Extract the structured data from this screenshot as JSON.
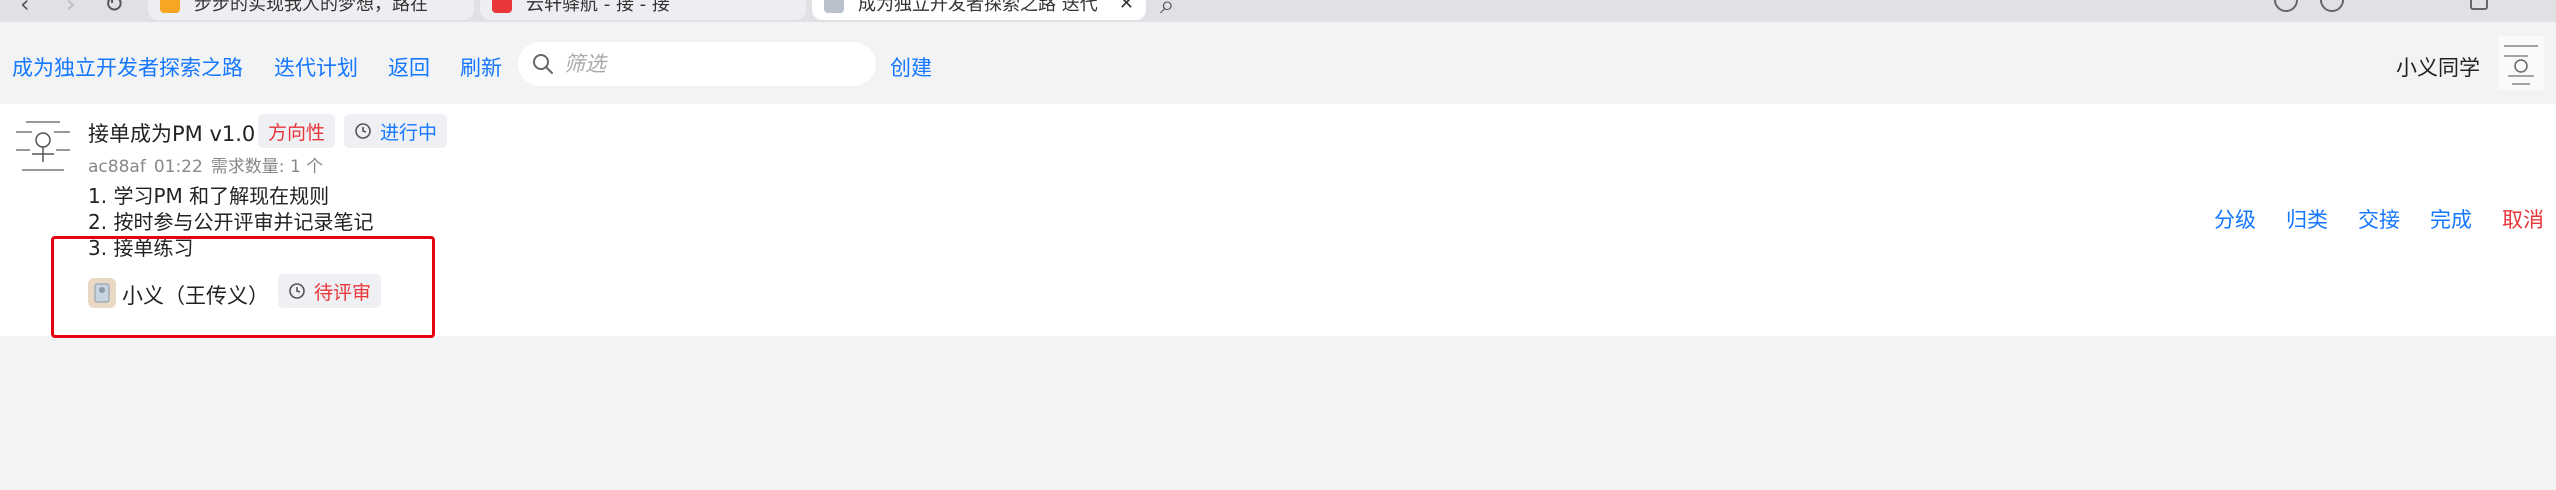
{
  "browser": {
    "tabs": [
      {
        "title": "步步的实现我人的梦想，路在"
      },
      {
        "title": "云轩驿航 - 接 - 接"
      },
      {
        "title": "成为独立开发者探索之路 迭代"
      }
    ],
    "close_glyph": "✕",
    "search_glyph": "⌕"
  },
  "topbar": {
    "project_link": "成为独立开发者探索之路",
    "iteration_link": "迭代计划",
    "back_link": "返回",
    "refresh_link": "刷新",
    "search_placeholder": "筛选",
    "create_link": "创建",
    "username": "小义同学"
  },
  "item": {
    "title": "接单成为PM v1.0",
    "tag_direction": "方向性",
    "tag_status": "进行中",
    "hash": "ac88af",
    "time": "01:22",
    "count_label": "需求数量: 1 个",
    "requirements": [
      "1. 学习PM 和了解现在规则",
      "2. 按时参与公开评审并记录笔记",
      "3. 接单练习"
    ],
    "assignee": "小义（王传义）",
    "review_status": "待评审"
  },
  "actions": {
    "grade": "分级",
    "classify": "归类",
    "handover": "交接",
    "complete": "完成",
    "cancel": "取消"
  },
  "colors": {
    "link_blue": "#1677ff",
    "danger_red": "#e8363a",
    "highlight_red": "#e60012",
    "page_bg": "#f2f3f5"
  }
}
